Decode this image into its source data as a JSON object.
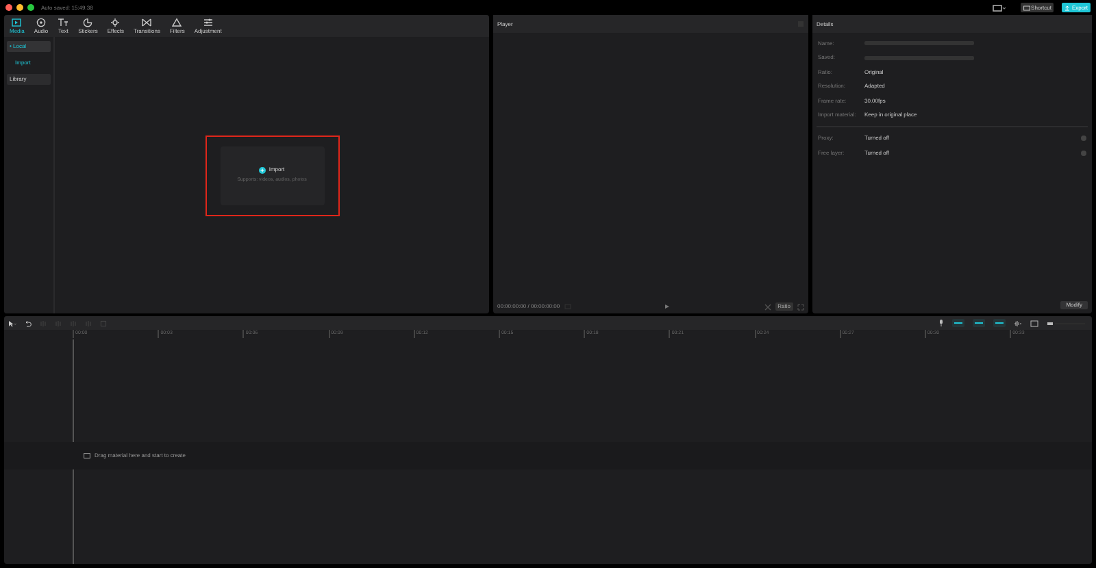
{
  "window": {
    "autosave": "Auto saved: 15:49:38",
    "shortcut": "Shortcut",
    "export": "Export"
  },
  "tabs": [
    {
      "label": "Media",
      "selected": true
    },
    {
      "label": "Audio",
      "selected": false
    },
    {
      "label": "Text",
      "selected": false
    },
    {
      "label": "Stickers",
      "selected": false
    },
    {
      "label": "Effects",
      "selected": false
    },
    {
      "label": "Transitions",
      "selected": false
    },
    {
      "label": "Filters",
      "selected": false
    },
    {
      "label": "Adjustment",
      "selected": false
    }
  ],
  "sidebar": {
    "items": [
      {
        "label": "• Local",
        "selected": true,
        "kind": "header"
      },
      {
        "label": "Import",
        "selected": true,
        "kind": "link"
      },
      {
        "label": "Library",
        "selected": false,
        "kind": "header"
      }
    ]
  },
  "import_box": {
    "title": "Import",
    "hint": "Supports: videos, audios, photos"
  },
  "player": {
    "title": "Player",
    "time": "00:00:00:00 / 00:00:00:00",
    "ratio": "Ratio"
  },
  "details": {
    "title": "Details",
    "rows": [
      {
        "label": "Name:"
      },
      {
        "label": "Saved:"
      },
      {
        "label": "Ratio:",
        "value": "Original"
      },
      {
        "label": "Resolution:",
        "value": "Adapted"
      },
      {
        "label": "Frame rate:",
        "value": "30.00fps"
      },
      {
        "label": "Import material:",
        "value": "Keep in original place"
      }
    ],
    "toggles": [
      {
        "label": "Proxy:",
        "value": "Turned off",
        "on": false
      },
      {
        "label": "Free layer:",
        "value": "Turned off",
        "on": false
      }
    ],
    "modify": "Modify"
  },
  "timeline": {
    "toggles": [
      {
        "on": true
      },
      {
        "on": true
      },
      {
        "on": true
      }
    ],
    "ticks": [
      "00:00",
      "00:03",
      "00:06",
      "00:09",
      "00:12",
      "00:15",
      "00:18",
      "00:21",
      "00:24",
      "00:27",
      "00:30",
      "00:33"
    ],
    "hint": "Drag material here and start to create"
  }
}
